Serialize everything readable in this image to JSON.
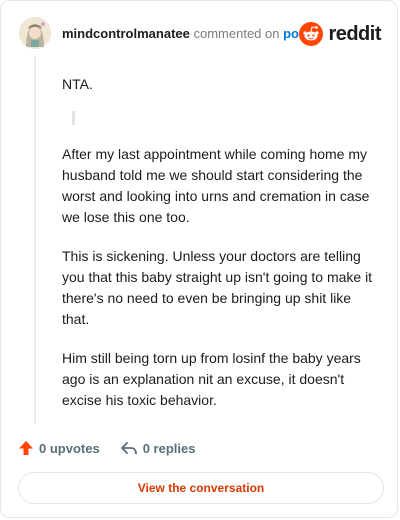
{
  "header": {
    "username": "mindcontrolmanatee",
    "commented_on": "commented on",
    "post_link": "post",
    "brand": "reddit"
  },
  "comment": {
    "opening": "NTA.",
    "paragraphs": [
      "After my last appointment while coming home my husband told me we should start considering the worst and looking into urns and cremation in case we lose this one too.",
      "This is sickening. Unless your doctors are telling you that this baby straight up isn't going to make it there's no need to even be bringing up shit like that.",
      "Him still being torn up from losinf the baby years ago is an explanation nit an excuse, it doesn't excise his toxic behavior."
    ]
  },
  "actions": {
    "upvotes_label": "0 upvotes",
    "replies_label": "0 replies"
  },
  "footer": {
    "view_conversation": "View the conversation"
  },
  "colors": {
    "brand_orange": "#ff4500",
    "link_blue": "#0079d3",
    "cta_text": "#d93a00"
  },
  "icons": {
    "avatar": "user-avatar",
    "logo": "reddit-snoo-icon",
    "upvote": "upvote-arrow-icon",
    "reply": "reply-arrow-icon"
  }
}
